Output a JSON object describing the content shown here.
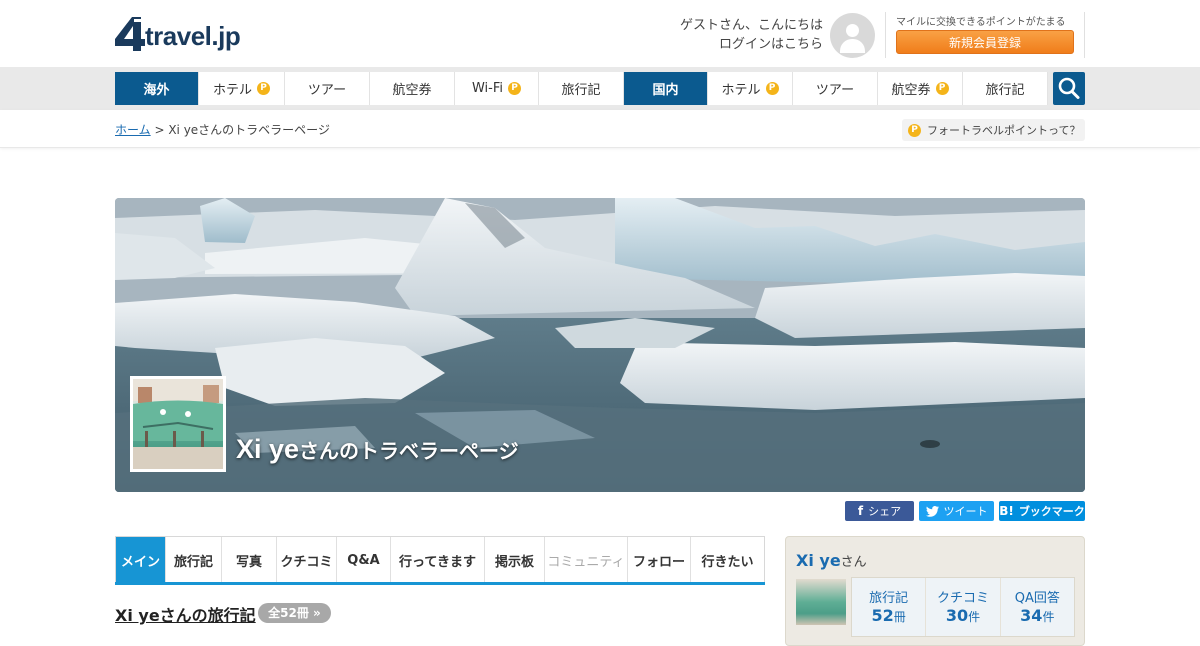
{
  "header": {
    "logo_text": "travel.jp",
    "greeting": "ゲストさん、こんにちは",
    "login_link": "ログインはこちら",
    "mile_note": "マイルに交換できるポイントがたまる",
    "register_label": "新規会員登録"
  },
  "nav": {
    "items": [
      {
        "label": "海外",
        "section": true,
        "points": false
      },
      {
        "label": "ホテル",
        "section": false,
        "points": true
      },
      {
        "label": "ツアー",
        "section": false,
        "points": false
      },
      {
        "label": "航空券",
        "section": false,
        "points": false
      },
      {
        "label": "Wi-Fi",
        "section": false,
        "points": true
      },
      {
        "label": "旅行記",
        "section": false,
        "points": false
      },
      {
        "label": "国内",
        "section": true,
        "points": false
      },
      {
        "label": "ホテル",
        "section": false,
        "points": true
      },
      {
        "label": "ツアー",
        "section": false,
        "points": false
      },
      {
        "label": "航空券",
        "section": false,
        "points": true
      },
      {
        "label": "旅行記",
        "section": false,
        "points": false
      }
    ],
    "points_glyph": "P"
  },
  "breadcrumb": {
    "home": "ホーム",
    "separator": " > ",
    "current": "Xi yeさんのトラベラーページ"
  },
  "points_link": "フォートラベルポイントって？",
  "hero": {
    "name": "Xi ye",
    "suffix": "さんのトラベラーページ"
  },
  "share": {
    "facebook": "シェア",
    "twitter": "ツイート",
    "hatena": "ブックマーク",
    "hatena_icon": "B!"
  },
  "tabs": [
    {
      "label": "メイン",
      "active": true,
      "disabled": false
    },
    {
      "label": "旅行記",
      "active": false,
      "disabled": false
    },
    {
      "label": "写真",
      "active": false,
      "disabled": false
    },
    {
      "label": "クチコミ",
      "active": false,
      "disabled": false
    },
    {
      "label": "Q&A",
      "active": false,
      "disabled": false
    },
    {
      "label": "行ってきます",
      "active": false,
      "disabled": false
    },
    {
      "label": "掲示板",
      "active": false,
      "disabled": false
    },
    {
      "label": "コミュニティ",
      "active": false,
      "disabled": true
    },
    {
      "label": "フォロー",
      "active": false,
      "disabled": false
    },
    {
      "label": "行きたい",
      "active": false,
      "disabled": false
    }
  ],
  "section": {
    "title": "Xi yeさんの旅行記",
    "count_label": "全52冊 »"
  },
  "profile": {
    "name": "Xi ye",
    "san": "さん",
    "stats": [
      {
        "label": "旅行記",
        "value": "52",
        "unit": "冊"
      },
      {
        "label": "クチコミ",
        "value": "30",
        "unit": "件"
      },
      {
        "label": "QA回答",
        "value": "34",
        "unit": "件"
      }
    ]
  },
  "colors": {
    "brand_blue": "#0b5a8f",
    "tab_active": "#1795d4",
    "register_orange": "#f07d1a",
    "points_yellow": "#f4b41a"
  }
}
